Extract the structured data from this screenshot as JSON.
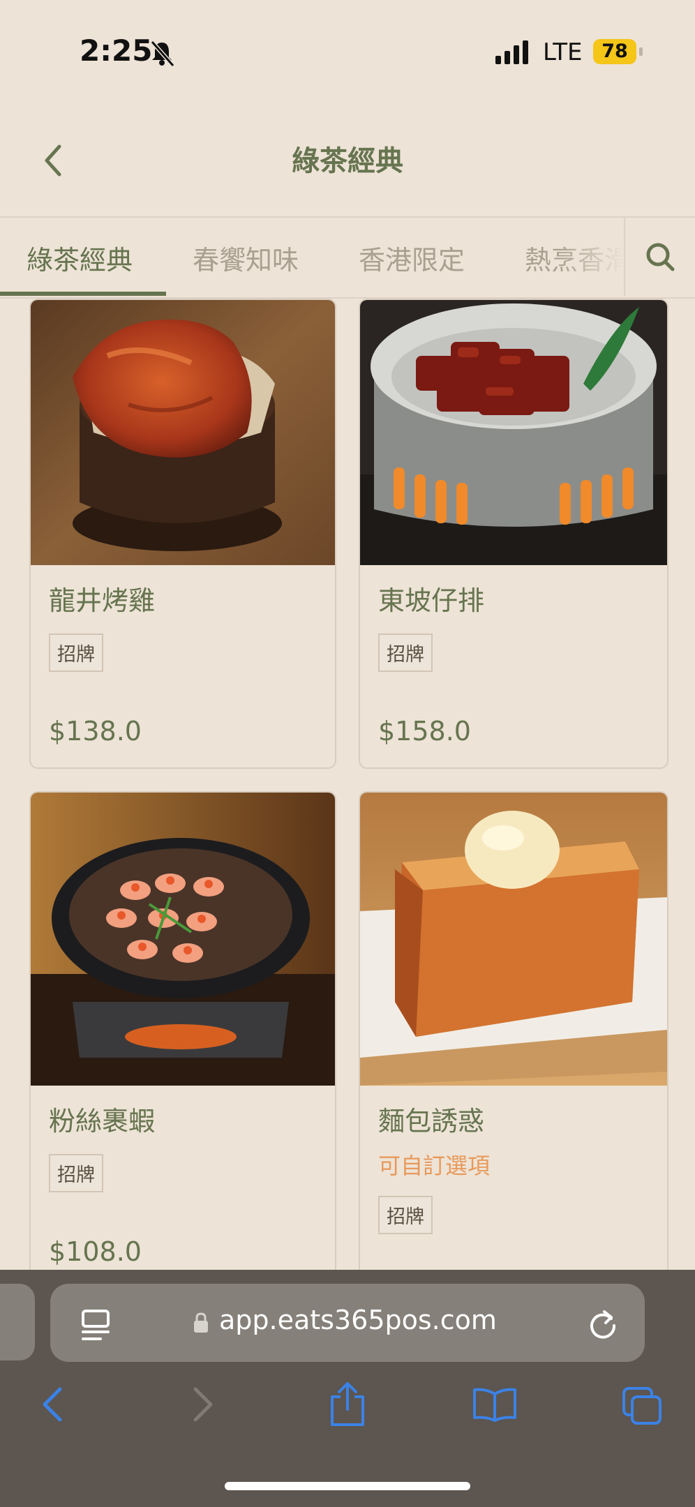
{
  "status_bar": {
    "time": "2:25",
    "network": "LTE",
    "battery": "78"
  },
  "header": {
    "title": "綠茶經典"
  },
  "tabs": [
    {
      "label": "綠茶經典",
      "active": true
    },
    {
      "label": "春饗知味",
      "active": false
    },
    {
      "label": "香港限定",
      "active": false
    },
    {
      "label": "熱烹香滑",
      "active": false
    }
  ],
  "menu_items": [
    {
      "name": "龍井烤雞",
      "tag": "招牌",
      "price": "$138.0",
      "option_note": ""
    },
    {
      "name": "東坡仔排",
      "tag": "招牌",
      "price": "$158.0",
      "option_note": ""
    },
    {
      "name": "粉絲裹蝦",
      "tag": "招牌",
      "price": "$108.0",
      "option_note": ""
    },
    {
      "name": "麵包誘惑",
      "tag": "招牌",
      "price": "",
      "option_note": "可自訂選項"
    }
  ],
  "browser": {
    "url": "app.eats365pos.com"
  },
  "colors": {
    "accent": "#66744f",
    "background": "#ede3d6",
    "option_orange": "#e8995b",
    "safari_blue": "#3b82e6"
  }
}
